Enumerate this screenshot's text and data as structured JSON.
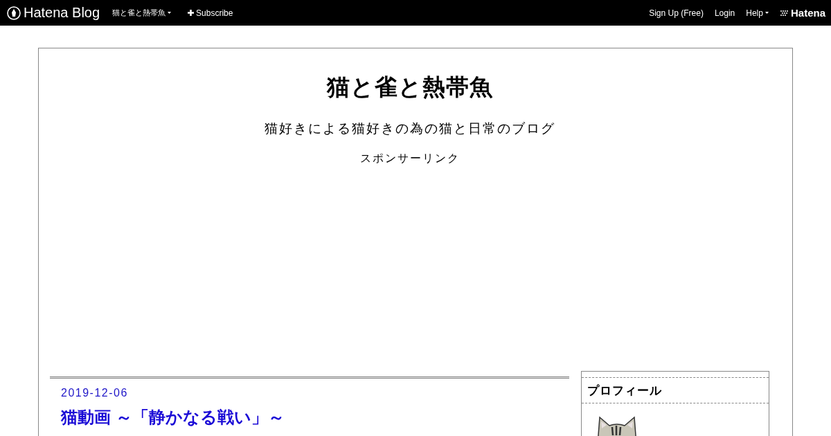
{
  "global_header": {
    "logo": "Hatena Blog",
    "blog_menu": "猫と雀と熱帯魚",
    "subscribe": "Subscribe",
    "right_links": [
      {
        "label": "Sign Up (Free)",
        "kind": "link"
      },
      {
        "label": "Login",
        "kind": "link"
      },
      {
        "label": "Help",
        "kind": "menu"
      }
    ],
    "brand": "Hatena"
  },
  "blog": {
    "title": "猫と雀と熱帯魚",
    "description": "猫好きによる猫好きの為の猫と日常のブログ",
    "sponsor_label": "スポンサーリンク"
  },
  "entry": {
    "date": "2019-12-06",
    "title": "猫動画 ～「静かなる戦い」～"
  },
  "sidebar": {
    "modules": [
      {
        "title": "プロフィール"
      }
    ]
  }
}
